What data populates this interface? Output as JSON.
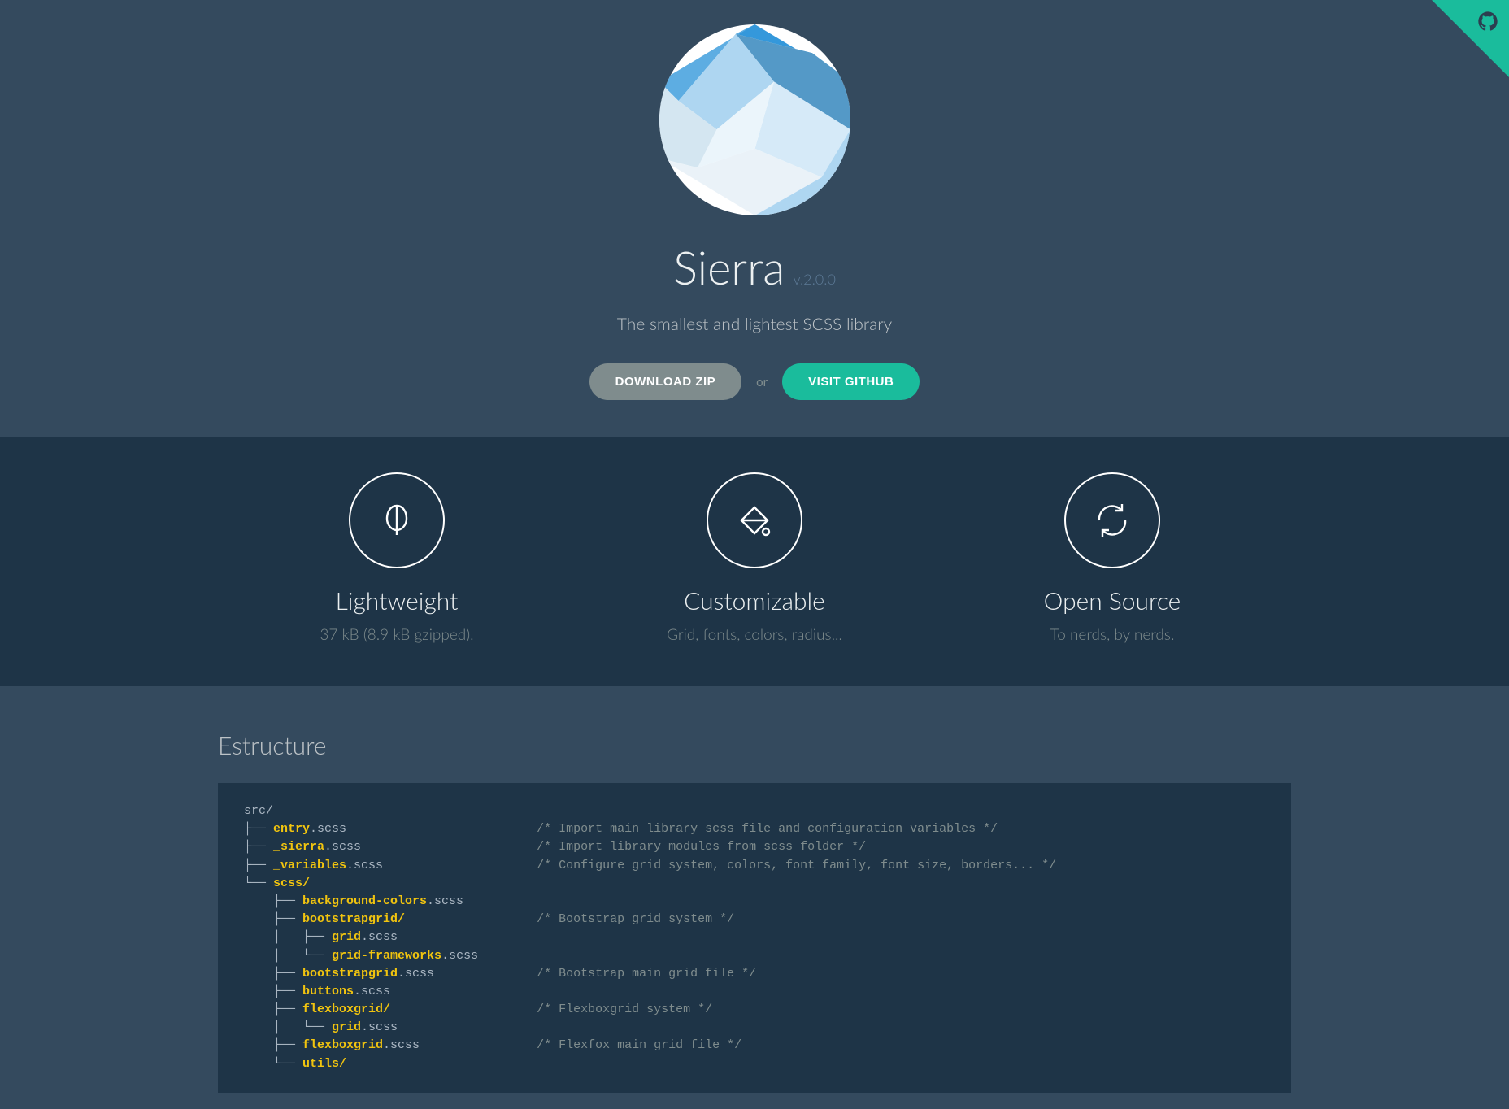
{
  "hero": {
    "title": "Sierra",
    "version": "v.2.0.0",
    "tagline": "The smallest and lightest SCSS library",
    "download_label": "DOWNLOAD ZIP",
    "or": "or",
    "github_label": "VISIT GITHUB"
  },
  "features": [
    {
      "title": "Lightweight",
      "desc": "37 kB (8.9 kB gzipped).",
      "icon": "leaf"
    },
    {
      "title": "Customizable",
      "desc": "Grid, fonts, colors, radius...",
      "icon": "paint"
    },
    {
      "title": "Open Source",
      "desc": "To nerds, by nerds.",
      "icon": "refresh"
    }
  ],
  "structure": {
    "heading": "Estructure",
    "lines": [
      {
        "indent": 0,
        "prefix": "",
        "name": "src/",
        "hl": false,
        "comment": ""
      },
      {
        "indent": 0,
        "prefix": "├── ",
        "name": "entry",
        "ext": ".scss",
        "hl": true,
        "comment": "/* Import main library scss file and configuration variables */"
      },
      {
        "indent": 0,
        "prefix": "├── ",
        "name": "_sierra",
        "ext": ".scss",
        "hl": true,
        "comment": "/* Import library modules from scss folder */"
      },
      {
        "indent": 0,
        "prefix": "├── ",
        "name": "_variables",
        "ext": ".scss",
        "hl": true,
        "comment": "/* Configure grid system, colors, font family, font size, borders... */"
      },
      {
        "indent": 0,
        "prefix": "└── ",
        "name": "scss/",
        "hl": true,
        "comment": ""
      },
      {
        "indent": 1,
        "prefix": "├── ",
        "name": "background-colors",
        "ext": ".scss",
        "hl": true,
        "comment": ""
      },
      {
        "indent": 1,
        "prefix": "├── ",
        "name": "bootstrapgrid/",
        "hl": true,
        "comment": "/* Bootstrap grid system */"
      },
      {
        "indent": 1,
        "prefix": "│   ├── ",
        "name": "grid",
        "ext": ".scss",
        "hl": true,
        "comment": ""
      },
      {
        "indent": 1,
        "prefix": "│   └── ",
        "name": "grid-frameworks",
        "ext": ".scss",
        "hl": true,
        "comment": ""
      },
      {
        "indent": 1,
        "prefix": "├── ",
        "name": "bootstrapgrid",
        "ext": ".scss",
        "hl": true,
        "comment": "/* Bootstrap main grid file */"
      },
      {
        "indent": 1,
        "prefix": "├── ",
        "name": "buttons",
        "ext": ".scss",
        "hl": true,
        "comment": ""
      },
      {
        "indent": 1,
        "prefix": "├── ",
        "name": "flexboxgrid/",
        "hl": true,
        "comment": "/* Flexboxgrid system */"
      },
      {
        "indent": 1,
        "prefix": "│   └── ",
        "name": "grid",
        "ext": ".scss",
        "hl": true,
        "comment": ""
      },
      {
        "indent": 1,
        "prefix": "├── ",
        "name": "flexboxgrid",
        "ext": ".scss",
        "hl": true,
        "comment": "/* Flexfox main grid file */"
      },
      {
        "indent": 1,
        "prefix": "└── ",
        "name": "utils/",
        "hl": true,
        "comment": ""
      }
    ]
  }
}
